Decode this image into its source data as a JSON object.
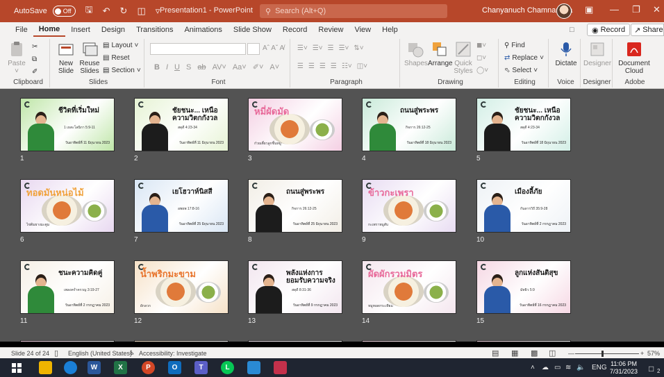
{
  "titlebar": {
    "autosave_label": "AutoSave",
    "autosave_state": "Off",
    "document_title": "Presentation1 - PowerPoint",
    "search_placeholder": "Search (Alt+Q)",
    "user_name": "Chanyanuch Chamnan-Ua",
    "accent_color": "#b7472a"
  },
  "tabs": [
    "File",
    "Home",
    "Insert",
    "Design",
    "Transitions",
    "Animations",
    "Slide Show",
    "Record",
    "Review",
    "View",
    "Help"
  ],
  "active_tab": "Home",
  "header_buttons": {
    "record": "Record",
    "share": "Share"
  },
  "ribbon": {
    "clipboard": {
      "paste": "Paste",
      "label": "Clipboard"
    },
    "slides": {
      "new_slide": "New Slide",
      "reuse_slides": "Reuse Slides",
      "layout": "Layout",
      "reset": "Reset",
      "section": "Section",
      "label": "Slides"
    },
    "font": {
      "label": "Font"
    },
    "paragraph": {
      "label": "Paragraph"
    },
    "drawing": {
      "shapes": "Shapes",
      "arrange": "Arrange",
      "quick_styles": "Quick Styles",
      "label": "Drawing"
    },
    "editing": {
      "find": "Find",
      "replace": "Replace",
      "select": "Select",
      "label": "Editing"
    },
    "voice": {
      "dictate": "Dictate",
      "label": "Voice"
    },
    "designer": {
      "designer": "Designer",
      "label": "Designer"
    },
    "adobe": {
      "document_cloud": "Document Cloud",
      "label": "Adobe"
    }
  },
  "slides": [
    {
      "number": "1",
      "title": "ชีวิตที่เริ่มใหม่",
      "sub": "1 เธสะโลนิกา 5:9-11",
      "date": "วันอาทิตย์ที่ 11 มิถุนายน 2023",
      "bg": "#bfe6a8",
      "accent": "#2f8a3a",
      "kind": "person"
    },
    {
      "number": "2",
      "title": "ชัยชนะ... เหนือความวิตกกังวล",
      "sub": "สดุดี 4:23-34",
      "date": "วันอาทิตย์ที่ 11 มิถุนายน 2023",
      "bg": "#e6f3d4",
      "accent": "#1c1c1c",
      "kind": "person"
    },
    {
      "number": "3",
      "title": "หมี่ผัดมัด",
      "sub": "ก๋วยเตี๋ยวลูกชิ้นหมู",
      "date": "",
      "bg": "#f4cfe3",
      "accent": "#e86a9a",
      "kind": "food"
    },
    {
      "number": "4",
      "title": "ถนนสู่พระพร",
      "sub": "กิจการ 26:12-25",
      "date": "วันอาทิตย์ที่ 18 มิถุนายน 2023",
      "bg": "#c9ead9",
      "accent": "#2f8a3a",
      "kind": "person"
    },
    {
      "number": "5",
      "title": "ชัยชนะ... เหนือความวิตกกังวล",
      "sub": "สดุดี 4:23-34",
      "date": "วันอาทิตย์ที่ 18 มิถุนายน 2023",
      "bg": "#d3efe6",
      "accent": "#1c1c1c",
      "kind": "person"
    },
    {
      "number": "6",
      "title": "ทอดมันหน่อไม้",
      "sub": "ไข่ต้มยางมะตูม",
      "date": "",
      "bg": "#e8d8f0",
      "accent": "#f0a23c",
      "kind": "food"
    },
    {
      "number": "7",
      "title": "เยโฮวาห์นิสสี",
      "sub": "อพยพ 17:8-16",
      "date": "วันอาทิตย์ที่ 25 มิถุนายน 2023",
      "bg": "#d9e6f4",
      "accent": "#2a5aa8",
      "kind": "person"
    },
    {
      "number": "8",
      "title": "ถนนสู่พระพร",
      "sub": "กิจการ 26:12-25",
      "date": "วันอาทิตย์ที่ 25 มิถุนายน 2023",
      "bg": "#f2eee6",
      "accent": "#1c1c1c",
      "kind": "person"
    },
    {
      "number": "9",
      "title": "ข้าวกะเพรา",
      "sub": "กะเพราหมูสับ",
      "date": "",
      "bg": "#e8dcf2",
      "accent": "#e86a9a",
      "kind": "food"
    },
    {
      "number": "10",
      "title": "เมืองลี้ภัย",
      "sub": "กันดารวิถี 35:9-28",
      "date": "วันอาทิตย์ที่ 2 กรกฎาคม 2023",
      "bg": "#eef2f6",
      "accent": "#2a5aa8",
      "kind": "person"
    },
    {
      "number": "11",
      "title": "ชนะความคิดคู่",
      "sub": "เพลงคร่ำครวญ 3:19-27",
      "date": "วันอาทิตย์ที่ 2 กรกฎาคม 2023",
      "bg": "#f6f0e6",
      "accent": "#2f8a3a",
      "kind": "person"
    },
    {
      "number": "12",
      "title": "น้ำพริกมะขาม",
      "sub": "ผักลวก",
      "date": "",
      "bg": "#f6e2c8",
      "accent": "#e8742c",
      "kind": "food"
    },
    {
      "number": "13",
      "title": "พลังแห่งการยอมรับความจริง",
      "sub": "สดุดี 8:31-36",
      "date": "วันอาทิตย์ที่ 9 กรกฎาคม 2023",
      "bg": "#f2e6ef",
      "accent": "#1c1c1c",
      "kind": "person"
    },
    {
      "number": "14",
      "title": "ผัดผักรวมมิตร",
      "sub": "หมูทอดกระเทียม",
      "date": "",
      "bg": "#f4e6ee",
      "accent": "#e86a9a",
      "kind": "food"
    },
    {
      "number": "15",
      "title": "ลูกแห่งสันติสุข",
      "sub": "มัทธิว 5:9",
      "date": "วันอาทิตย์ที่ 16 กรกฎาคม 2023",
      "bg": "#f6d8e4",
      "accent": "#2a5aa8",
      "kind": "person"
    }
  ],
  "partial_row_colors": [
    "#f4cfe3",
    "#f6e2c8",
    "#f2e6ef",
    "#f6d8e4",
    "#f6d8e4"
  ],
  "statusbar": {
    "slide_info": "Slide 24 of 24",
    "language": "English (United States)",
    "accessibility": "Accessibility: Investigate",
    "zoom": "57%"
  },
  "taskbar": {
    "language": "ENG",
    "time": "11:06 PM",
    "date": "7/31/2023",
    "notifications": "2"
  }
}
